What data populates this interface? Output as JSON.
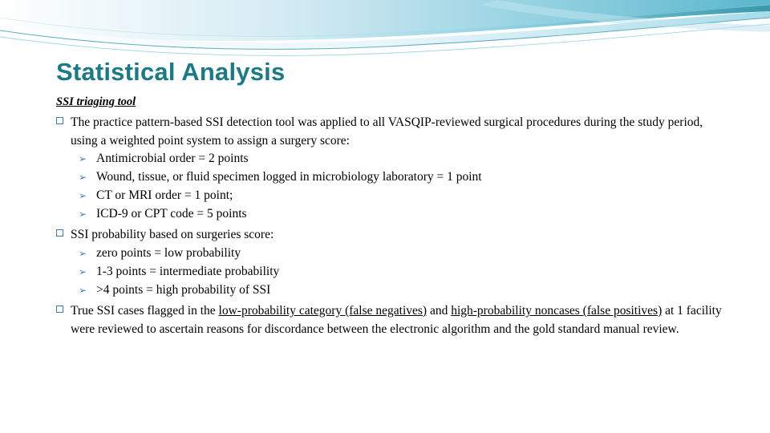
{
  "slide": {
    "title": "Statistical Analysis",
    "subhead": "SSI triaging tool",
    "bullets": [
      {
        "level": 1,
        "marker": "square",
        "text": "The practice pattern-based SSI detection tool was applied to all VASQIP-reviewed surgical procedures during the study period, using a weighted point system to assign a surgery score:"
      },
      {
        "level": 2,
        "marker": "arrow",
        "text": "Antimicrobial order = 2 points"
      },
      {
        "level": 2,
        "marker": "arrow",
        "text": "Wound, tissue, or fluid specimen logged in microbiology laboratory = 1 point"
      },
      {
        "level": 2,
        "marker": "arrow",
        "text": "CT or MRI order = 1 point;"
      },
      {
        "level": 2,
        "marker": "arrow",
        "text": "ICD-9 or CPT code = 5 points"
      },
      {
        "level": 1,
        "marker": "square",
        "text": "SSI probability based on surgeries  score:"
      },
      {
        "level": 2,
        "marker": "arrow",
        "text": "zero points =  low probability"
      },
      {
        "level": 2,
        "marker": "arrow",
        "text": "1-3 points =   intermediate probability"
      },
      {
        "level": 2,
        "marker": "arrow",
        "text": ">4 points =   high probability of SSI"
      }
    ],
    "final_bullet": {
      "marker": "square",
      "part1": "True SSI cases flagged in the ",
      "underline1": "low-probability category (false negatives)",
      "part2": " and ",
      "underline2": "high-probability noncases (false positives)",
      "part3": " at 1 facility were  reviewed to ascertain reasons for discordance between the electronic algorithm and the gold standard manual review."
    },
    "arrow_glyph": "➢",
    "colors": {
      "title": "#1a7a86",
      "bullet": "#3a7fb5",
      "text": "#000000",
      "swoosh_dark": "#1f7f96",
      "swoosh_mid": "#55b6cc",
      "swoosh_light": "#bfe4ef"
    }
  }
}
